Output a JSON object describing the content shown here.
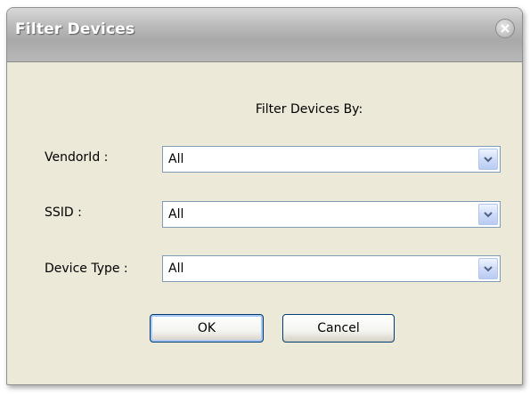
{
  "dialog": {
    "title": "Filter Devices",
    "heading": "Filter Devices By:"
  },
  "fields": {
    "vendor": {
      "label": "VendorId :",
      "value": "All"
    },
    "ssid": {
      "label": "SSID :",
      "value": "All"
    },
    "device_type": {
      "label": "Device Type :",
      "value": "All"
    }
  },
  "buttons": {
    "ok": "OK",
    "cancel": "Cancel"
  },
  "icons": {
    "close": "close-icon",
    "dropdown": "chevron-down-icon"
  },
  "colors": {
    "dialog_bg": "#ece9d8",
    "titlebar": "#b3b3b3",
    "combo_border": "#7f9db9",
    "button_border": "#003c74"
  }
}
